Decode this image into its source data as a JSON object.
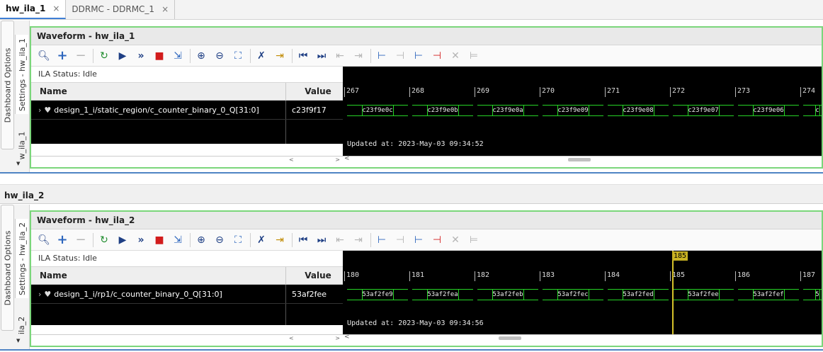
{
  "editor_tabs": [
    {
      "label": "hw_ila_1",
      "active": true
    },
    {
      "label": "DDRMC - DDRMC_1",
      "active": false
    }
  ],
  "side_tabs": {
    "dashboard_options": "Dashboard Options",
    "settings_1": "Settings - hw_ila_1",
    "short_1": "w_ila_1",
    "settings_2": "Settings - hw_ila_2",
    "short_2": "ila_2"
  },
  "section2_title": "hw_ila_2",
  "toolbar_icons": [
    "search-icon",
    "plus-icon",
    "minus-icon",
    "run-trigger-immediate-icon",
    "run-trigger-icon",
    "auto-rearm-icon",
    "stop-icon",
    "export-icon",
    "zoom-in-icon",
    "zoom-out-icon",
    "zoom-fit-icon",
    "remove-cursor-icon",
    "add-marker-icon",
    "go-first-icon",
    "go-last-icon",
    "prev-transition-icon",
    "next-transition-icon",
    "add-marker-icon",
    "prev-marker-icon",
    "next-marker-icon",
    "remove-marker-icon",
    "delete-icon",
    "swap-cursor-icon"
  ],
  "waveforms": [
    {
      "title": "Waveform - hw_ila_1",
      "ila_status": "ILA Status: Idle",
      "name_header": "Name",
      "value_header": "Value",
      "signal": {
        "name": "design_1_i/static_region/c_counter_binary_0_Q[31:0]",
        "value": "c23f9f17"
      },
      "ticks": [
        "267",
        "268",
        "269",
        "270",
        "271",
        "272",
        "273",
        "274"
      ],
      "segments": [
        "c23f9e0c",
        "c23f9e0b",
        "c23f9e0a",
        "c23f9e09",
        "c23f9e08",
        "c23f9e07",
        "c23f9e06",
        "c"
      ],
      "updated": "Updated at: 2023-May-03 09:34:52"
    },
    {
      "title": "Waveform - hw_ila_2",
      "ila_status": "ILA Status: Idle",
      "name_header": "Name",
      "value_header": "Value",
      "signal": {
        "name": "design_1_i/rp1/c_counter_binary_0_Q[31:0]",
        "value": "53af2fee"
      },
      "ticks": [
        "180",
        "181",
        "182",
        "183",
        "184",
        "185",
        "186",
        "187"
      ],
      "segments": [
        "53af2fe9",
        "53af2fea",
        "53af2feb",
        "53af2fec",
        "53af2fed",
        "53af2fee",
        "53af2fef",
        "5"
      ],
      "updated": "Updated at: 2023-May-03 09:34:56",
      "cursor_label": "185"
    }
  ],
  "colors": {
    "waveform_border": "#7bd67b",
    "bus_trace": "#26d326",
    "cursor": "#c9b223",
    "section_border": "#4f84c4"
  }
}
